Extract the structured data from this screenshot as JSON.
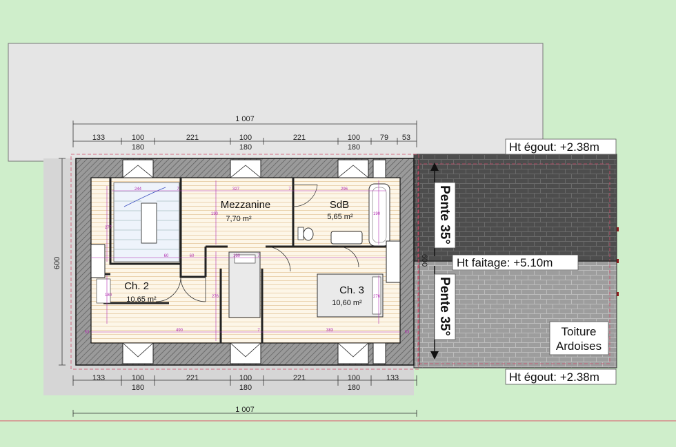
{
  "dims": {
    "top_total": "1 007",
    "top_row1": [
      "133",
      "100",
      "221",
      "100",
      "221",
      "100",
      "79",
      "53"
    ],
    "top_row2": [
      "180",
      "180",
      "180"
    ],
    "bottom_row1": [
      "133",
      "100",
      "221",
      "100",
      "221",
      "100",
      "133"
    ],
    "bottom_row2": [
      "180",
      "180",
      "180"
    ],
    "bottom_total": "1 007",
    "left_height": "600",
    "right_height": "600"
  },
  "rooms": {
    "mezzanine": {
      "name": "Mezzanine",
      "area": "7,70 m²"
    },
    "sdb": {
      "name": "SdB",
      "area": "5,65 m²"
    },
    "ch2": {
      "name": "Ch. 2",
      "area": "10,65 m²"
    },
    "ch3": {
      "name": "Ch. 3",
      "area": "10,60 m²"
    }
  },
  "inner_dims": [
    "244",
    "327",
    "296",
    "277",
    "190",
    "190",
    "60",
    "60",
    "160",
    "276",
    "490",
    "383",
    "180",
    "276",
    "7",
    "7",
    "7",
    "7",
    "53",
    "53"
  ],
  "roof": {
    "egout_top": "Ht égout: +2.38m",
    "egout_bottom": "Ht égout: +2.38m",
    "faitage": "Ht faitage: +5.10m",
    "pente_top": "Pente 35°",
    "pente_bottom": "Pente 35°",
    "material_line1": "Toiture",
    "material_line2": "Ardoises"
  },
  "colors": {
    "background": "#cfeecb",
    "roof_light": "#e5e5e5",
    "roof_dark": "#4d4d4d",
    "floor": "#fdf6e8",
    "dimension_magenta": "#b02bb0"
  }
}
